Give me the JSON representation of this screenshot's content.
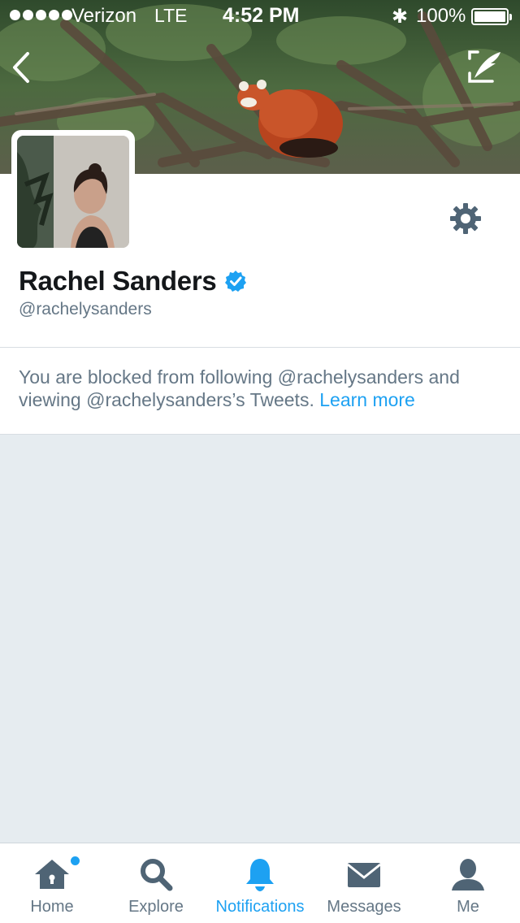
{
  "status_bar": {
    "carrier": "Verizon",
    "network": "LTE",
    "time": "4:52 PM",
    "bluetooth": "✱",
    "battery": "100%"
  },
  "profile": {
    "name": "Rachel Sanders",
    "handle": "@rachelysanders",
    "verified": true
  },
  "blocked_notice": {
    "text": "You are blocked from following @rachelysanders and viewing @rachelysanders’s Tweets.",
    "link": "Learn more"
  },
  "tabs": [
    {
      "label": "Home",
      "icon": "home-icon",
      "active": false,
      "badge": true
    },
    {
      "label": "Explore",
      "icon": "search-icon",
      "active": false
    },
    {
      "label": "Notifications",
      "icon": "bell-icon",
      "active": true
    },
    {
      "label": "Messages",
      "icon": "envelope-icon",
      "active": false
    },
    {
      "label": "Me",
      "icon": "person-icon",
      "active": false
    }
  ],
  "colors": {
    "accent": "#1da1f2",
    "text_primary": "#14171a",
    "text_secondary": "#657786",
    "background": "#e6ecf0"
  }
}
